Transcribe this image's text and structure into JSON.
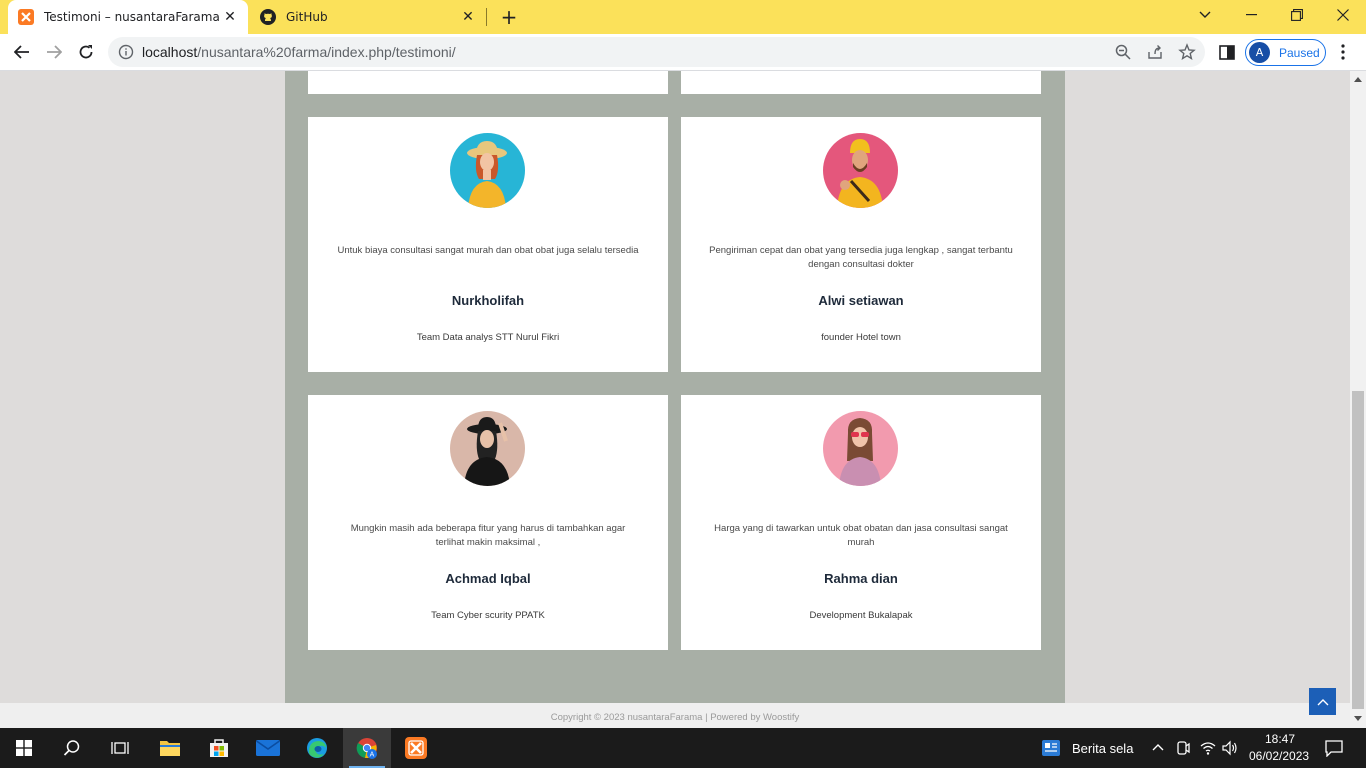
{
  "browser": {
    "tabs": [
      {
        "title": "Testimoni – nusantaraFarama",
        "favicon": "xampp-icon",
        "active": true
      },
      {
        "title": "GitHub",
        "favicon": "github-icon",
        "active": false
      }
    ],
    "url_host": "localhost",
    "url_path": "/nusantara%20farma/index.php/testimoni/",
    "profile_initial": "A",
    "profile_status": "Paused"
  },
  "testimonials": [
    {
      "quote": "Untuk biaya consultasi sangat murah dan obat obat juga selalu tersedia",
      "name": "Nurkholifah",
      "role": "Team Data analys STT Nurul Fikri",
      "avatar_bg": "#27b5d6"
    },
    {
      "quote": "Pengiriman cepat dan obat yang tersedia juga lengkap , sangat terbantu dengan consultasi dokter",
      "name": "Alwi setiawan",
      "role": "founder Hotel town",
      "avatar_bg": "#e4577c"
    },
    {
      "quote": "Mungkin masih ada beberapa fitur yang harus di tambahkan agar terlihat makin maksimal ,",
      "name": "Achmad Iqbal",
      "role": "Team Cyber scurity PPATK",
      "avatar_bg": "#d9b7a9"
    },
    {
      "quote": "Harga yang di tawarkan untuk obat obatan dan jasa consultasi sangat murah",
      "name": "Rahma dian",
      "role": "Development Bukalapak",
      "avatar_bg": "#f29aae"
    }
  ],
  "footer": {
    "text": "Copyright © 2023 nusantaraFarama | Powered by Woostify"
  },
  "taskbar": {
    "news_label": "Berita sela",
    "time": "18:47",
    "date": "06/02/2023"
  },
  "colors": {
    "tabstrip": "#fbe15a",
    "content_bg": "#a8afa6",
    "accent": "#1c5fb7"
  }
}
